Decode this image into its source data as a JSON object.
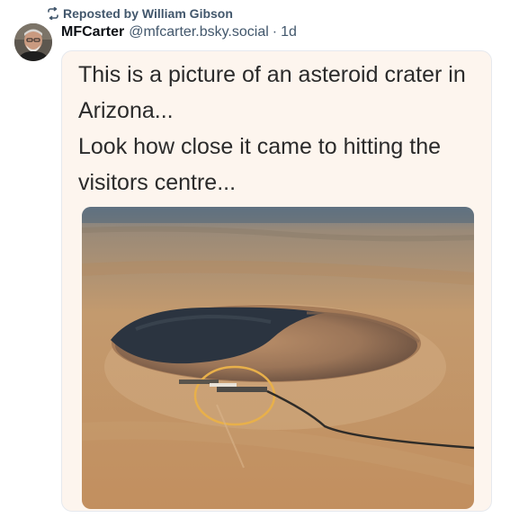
{
  "repost": {
    "label": "Reposted by William Gibson",
    "icon": "repost-icon"
  },
  "author": {
    "display_name": "MFCarter",
    "handle": "@mfcarter.bsky.social",
    "separator": "·",
    "timestamp": "1d",
    "avatar_icon": "avatar"
  },
  "embed": {
    "text_line1": "This is a picture of an asteroid crater in Arizona...",
    "text_line2": "Look how close it came to hitting the visitors centre...",
    "image_alt": "aerial photo of a meteor crater with a circled visitor centre"
  },
  "colors": {
    "muted": "#42576c",
    "card_bg": "#fdf5ee",
    "circle_highlight": "#e8b04a"
  }
}
